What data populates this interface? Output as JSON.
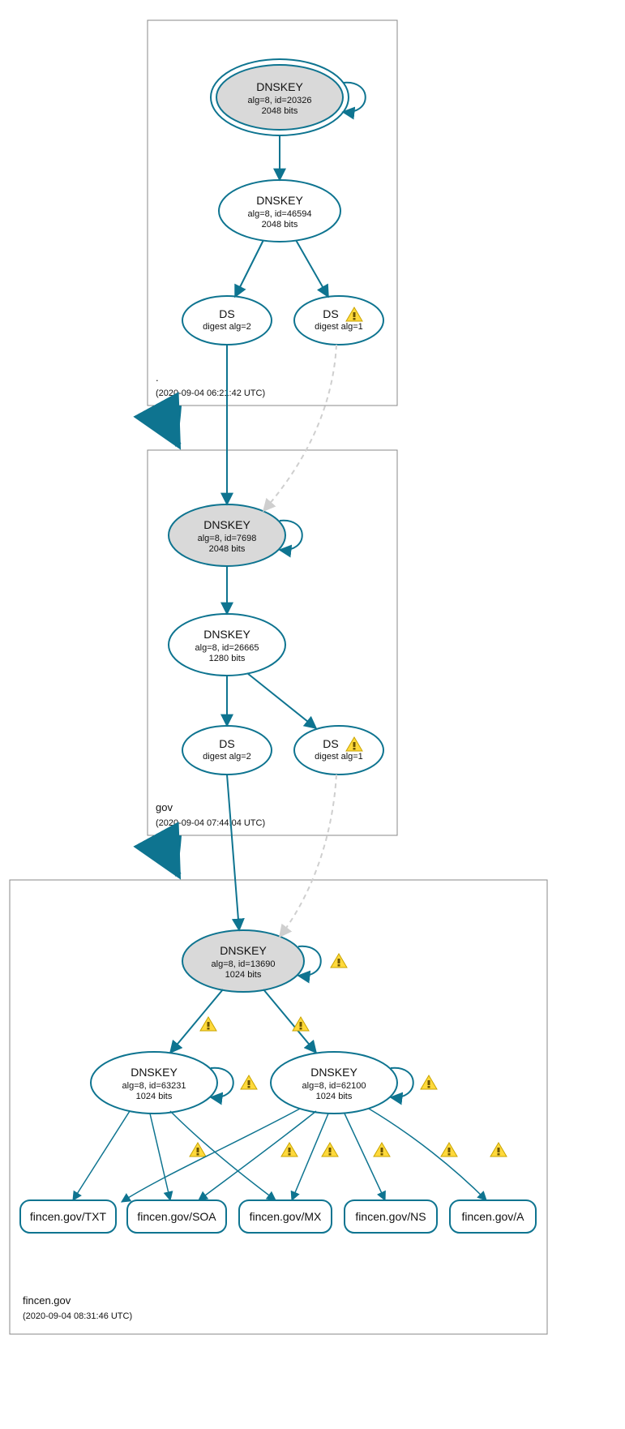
{
  "zones": {
    "root": {
      "label": ".",
      "timestamp": "(2020-09-04 06:21:42 UTC)"
    },
    "gov": {
      "label": "gov",
      "timestamp": "(2020-09-04 07:44:04 UTC)"
    },
    "fincen": {
      "label": "fincen.gov",
      "timestamp": "(2020-09-04 08:31:46 UTC)"
    }
  },
  "nodes": {
    "root_ksk": {
      "t": "DNSKEY",
      "s1": "alg=8, id=20326",
      "s2": "2048 bits"
    },
    "root_zsk": {
      "t": "DNSKEY",
      "s1": "alg=8, id=46594",
      "s2": "2048 bits"
    },
    "root_ds2": {
      "t": "DS",
      "s1": "digest alg=2"
    },
    "root_ds1": {
      "t": "DS",
      "s1": "digest alg=1"
    },
    "gov_ksk": {
      "t": "DNSKEY",
      "s1": "alg=8, id=7698",
      "s2": "2048 bits"
    },
    "gov_zsk": {
      "t": "DNSKEY",
      "s1": "alg=8, id=26665",
      "s2": "1280 bits"
    },
    "gov_ds2": {
      "t": "DS",
      "s1": "digest alg=2"
    },
    "gov_ds1": {
      "t": "DS",
      "s1": "digest alg=1"
    },
    "fin_ksk": {
      "t": "DNSKEY",
      "s1": "alg=8, id=13690",
      "s2": "1024 bits"
    },
    "fin_z1": {
      "t": "DNSKEY",
      "s1": "alg=8, id=63231",
      "s2": "1024 bits"
    },
    "fin_z2": {
      "t": "DNSKEY",
      "s1": "alg=8, id=62100",
      "s2": "1024 bits"
    }
  },
  "rr": {
    "txt": "fincen.gov/TXT",
    "soa": "fincen.gov/SOA",
    "mx": "fincen.gov/MX",
    "ns": "fincen.gov/NS",
    "a": "fincen.gov/A"
  }
}
